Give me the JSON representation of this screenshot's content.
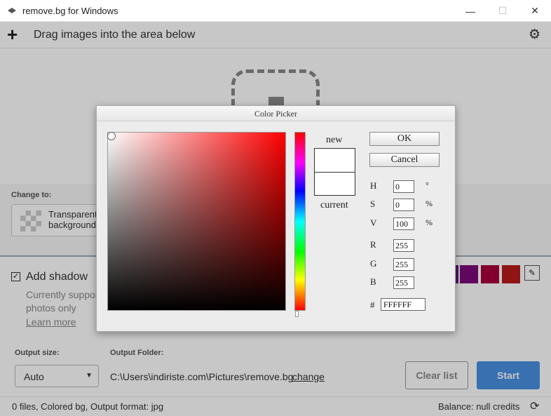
{
  "window": {
    "title": "remove.bg for Windows",
    "min_glyph": "—",
    "max_glyph": "☐",
    "close_glyph": "✕"
  },
  "toolbar": {
    "add_glyph": "+",
    "drag_text": "Drag images into the area below",
    "settings_glyph": "⚙"
  },
  "change_to": {
    "label": "Change to:",
    "option_line1": "Transparent",
    "option_line2": "background"
  },
  "shadow": {
    "checked_glyph": "✓",
    "label": "Add shadow",
    "note_line1": "Currently suppor",
    "note_line2": "photos only",
    "learn_more": "Learn more"
  },
  "swatches": [
    "#5a1e7a",
    "#7a0a7a",
    "#a8003c",
    "#b81c1c"
  ],
  "eyedropper_glyph": "✎",
  "output": {
    "size_label": "Output size:",
    "size_value": "Auto",
    "size_arrow": "▼",
    "folder_label": "Output Folder:",
    "folder_path": "C:\\Users\\indiriste.com\\Pictures\\remove.bg",
    "change_link": "change",
    "clear_button": "Clear list",
    "start_button": "Start"
  },
  "status": {
    "left_text": "0 files, Colored bg, Output format: jpg",
    "right_text": "Balance: null credits",
    "refresh_glyph": "⟳"
  },
  "color_picker": {
    "title": "Color Picker",
    "new_label": "new",
    "current_label": "current",
    "ok_button": "OK",
    "cancel_button": "Cancel",
    "fields": {
      "h_label": "H",
      "h_value": "0",
      "h_unit": "°",
      "s_label": "S",
      "s_value": "0",
      "s_unit": "%",
      "v_label": "V",
      "v_value": "100",
      "v_unit": "%",
      "r_label": "R",
      "r_value": "255",
      "g_label": "G",
      "g_value": "255",
      "b_label": "B",
      "b_value": "255",
      "hex_label": "#",
      "hex_value": "FFFFFF"
    },
    "hue_color": "#ff0000",
    "selected_color": "#ffffff"
  }
}
